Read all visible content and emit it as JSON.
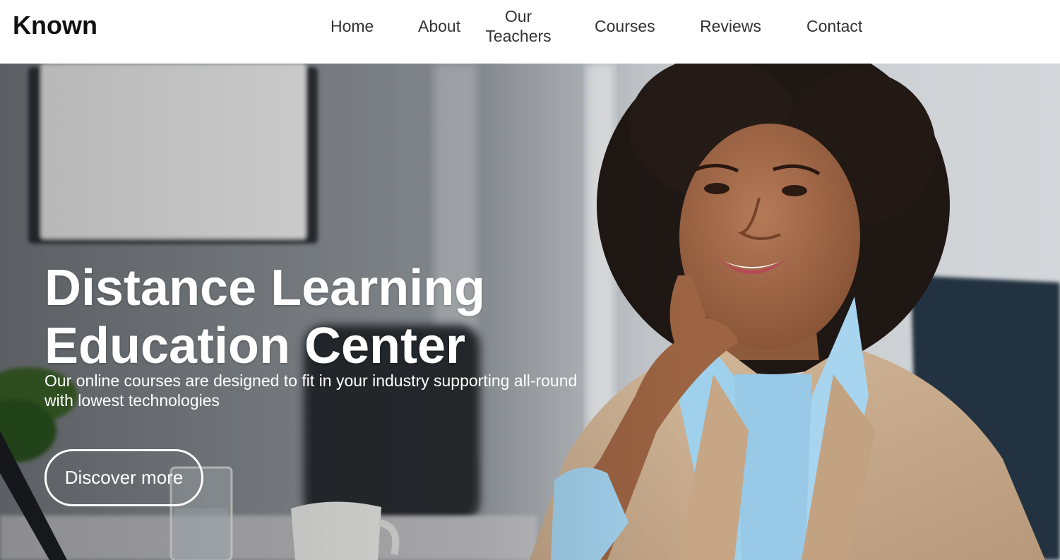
{
  "header": {
    "logo": "Known",
    "nav": {
      "home": "Home",
      "about": "About",
      "teachers_line1": "Our",
      "teachers_line2": "Teachers",
      "courses": "Courses",
      "reviews": "Reviews",
      "contact": "Contact"
    }
  },
  "hero": {
    "title_line1": "Distance Learning",
    "title_line2": "Education Center",
    "subtitle_line1": "Our online courses are designed to fit in your industry supporting all-round",
    "subtitle_line2": "with lowest technologies",
    "cta_label": "Discover more"
  },
  "colors": {
    "header_bg": "#ffffff",
    "nav_text": "#333333",
    "hero_text": "#ffffff",
    "blazer": "#c9ab8c",
    "shirt": "#9fd0ec",
    "hair": "#1f1714"
  }
}
